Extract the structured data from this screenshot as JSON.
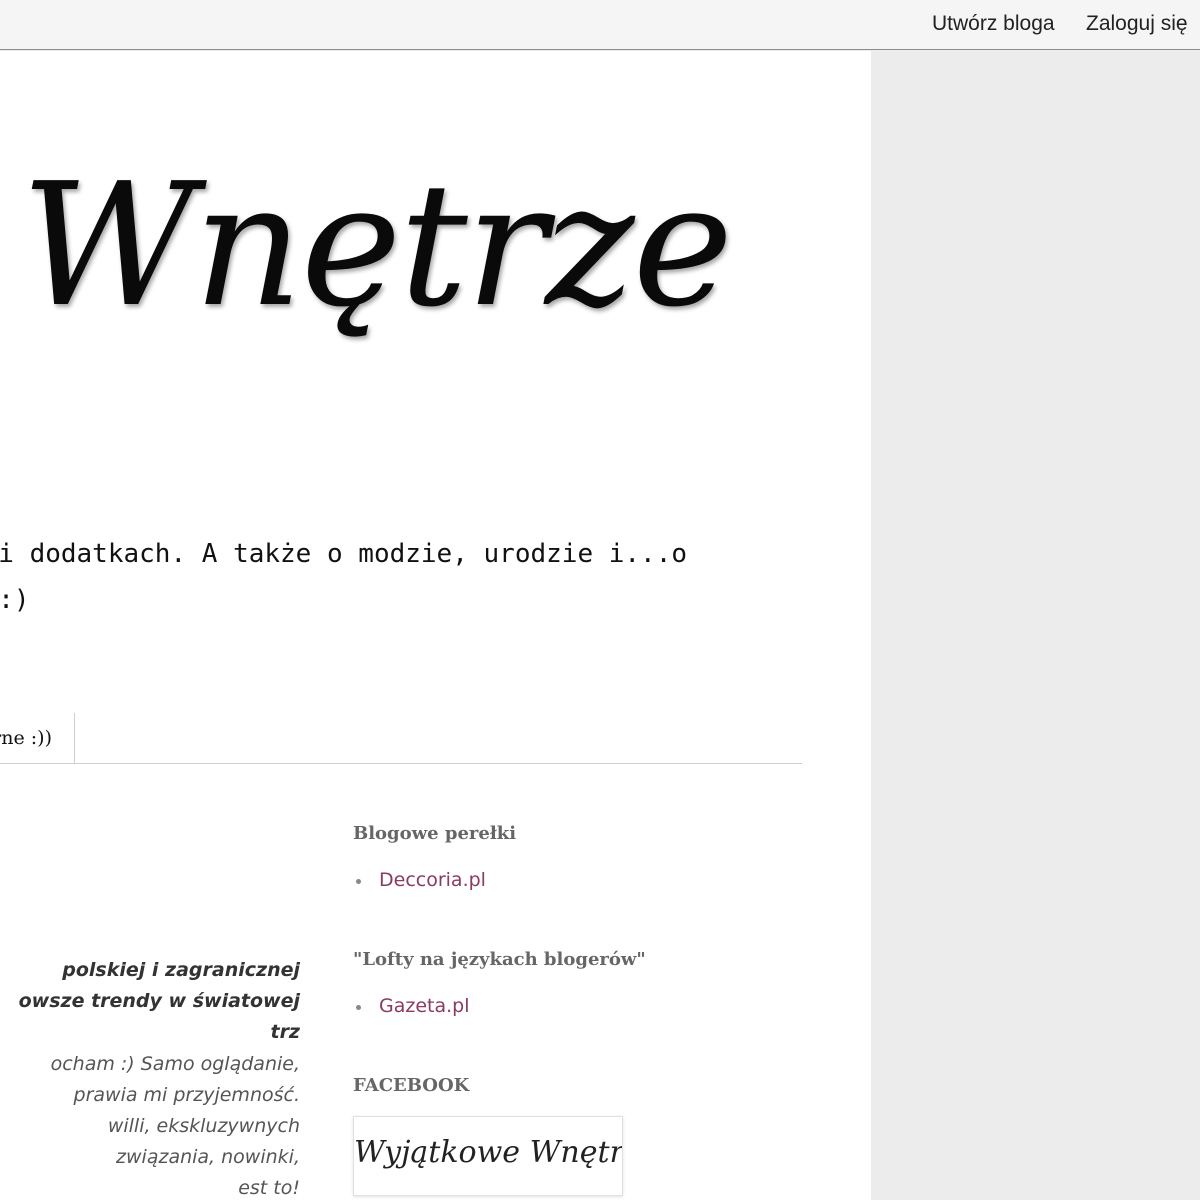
{
  "navbar": {
    "create_blog": "Utwórz bloga",
    "login": "Zaloguj się"
  },
  "header": {
    "title": "e Wnętrze"
  },
  "description": {
    "line1": "lach i dodatkach. A także o modzie, urodzie i...o",
    "line2": "guje :)"
  },
  "tabs": {
    "item_label": "rne :))"
  },
  "post": {
    "bold_lines": [
      "polskiej i zagranicznej",
      "owsze trendy w światowej",
      "trz"
    ],
    "text_lines": [
      "ocham :) Samo oglądanie,",
      "prawia mi przyjemność.",
      "willi, ekskluzywnych",
      "związania, nowinki,",
      "est to!"
    ]
  },
  "widgets": {
    "blogowe": {
      "title": "Blogowe perełki",
      "link": "Deccoria.pl"
    },
    "lofty": {
      "title": "\"Lofty na językach blogerów\"",
      "link": "Gazeta.pl"
    },
    "facebook": {
      "title": "FACEBOOK",
      "badge_text": "Wyjątkowe Wnętrze"
    }
  },
  "colors": {
    "link": "#8a3a63",
    "background": "#ececec"
  }
}
